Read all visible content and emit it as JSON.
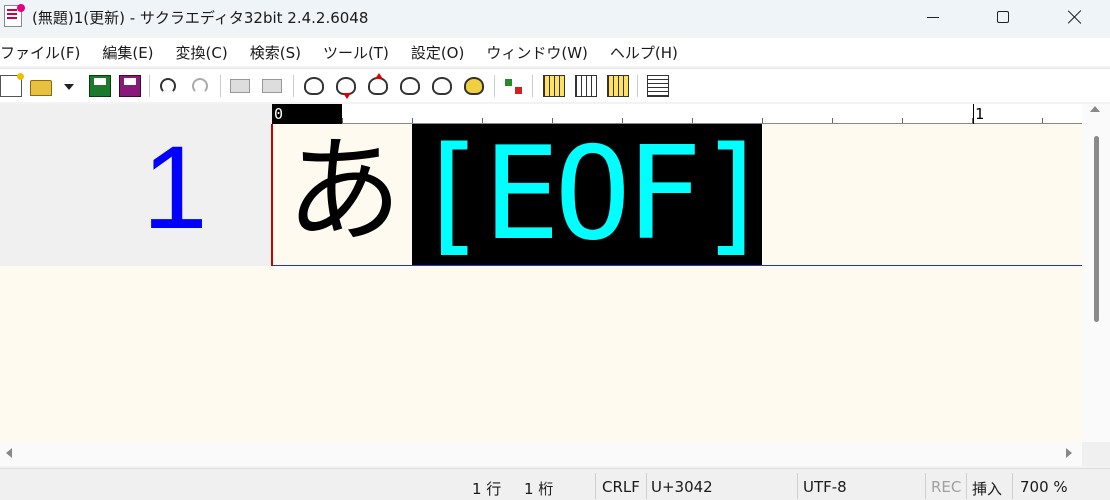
{
  "window": {
    "title": "(無題)1(更新) - サクラエディタ32bit 2.4.2.6048"
  },
  "menu": [
    "ファイル(F)",
    "編集(E)",
    "変換(C)",
    "検索(S)",
    "ツール(T)",
    "設定(O)",
    "ウィンドウ(W)",
    "ヘルプ(H)"
  ],
  "toolbar": {
    "icons": [
      "new-document-icon",
      "open-folder-icon",
      "dropdown-caret-icon",
      "save-icon",
      "save-as-icon",
      "undo-icon",
      "redo-icon",
      "jump-back-icon",
      "jump-forward-icon",
      "search-icon",
      "search-next-icon",
      "search-prev-icon",
      "search-mark-icon",
      "search-clear-icon",
      "grep-icon",
      "outline-icon",
      "type-settings-icon",
      "common-settings-icon",
      "font-settings-icon",
      "window-list-icon"
    ]
  },
  "editor": {
    "ruler_start": "0",
    "ruler_next": "1",
    "line_number": "1",
    "line_text": "あ",
    "eof_marker": "[EOF]",
    "colors": {
      "line_number": "#0000ff",
      "eof_text": "#00ffff",
      "eof_bg": "#000000",
      "caret": "#cc0000",
      "background": "#fffaf0"
    }
  },
  "status": {
    "row": "1 行",
    "col": "1 桁",
    "eol": "CRLF",
    "codepoint": "U+3042",
    "encoding": "UTF-8",
    "rec": "REC",
    "insert_mode": "挿入",
    "zoom": "700 %"
  }
}
